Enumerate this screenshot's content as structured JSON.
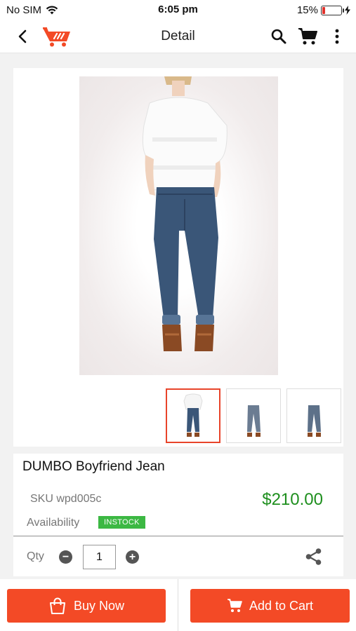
{
  "status_bar": {
    "carrier": "No SIM",
    "time": "6:05 pm",
    "battery_percent": "15%",
    "battery_level": 0.15
  },
  "header": {
    "title": "Detail",
    "icons": [
      "back-arrow-icon",
      "store-logo-icon",
      "search-icon",
      "cart-icon",
      "more-vertical-icon"
    ]
  },
  "product": {
    "name": "DUMBO Boyfriend Jean",
    "sku": "SKU wpd005c",
    "price": "$210.00",
    "availability_label": "Availability",
    "stock_status": "INSTOCK",
    "thumbnail_count": 3,
    "selected_thumbnail": 0
  },
  "quantity": {
    "label": "Qty",
    "value": "1",
    "minus": "−",
    "plus": "+"
  },
  "actions": {
    "buy_now": "Buy Now",
    "add_to_cart": "Add to Cart"
  },
  "colors": {
    "accent": "#f34a26",
    "price": "#1e8f1e",
    "instock": "#3cb843",
    "battery_low": "#e0322b"
  }
}
